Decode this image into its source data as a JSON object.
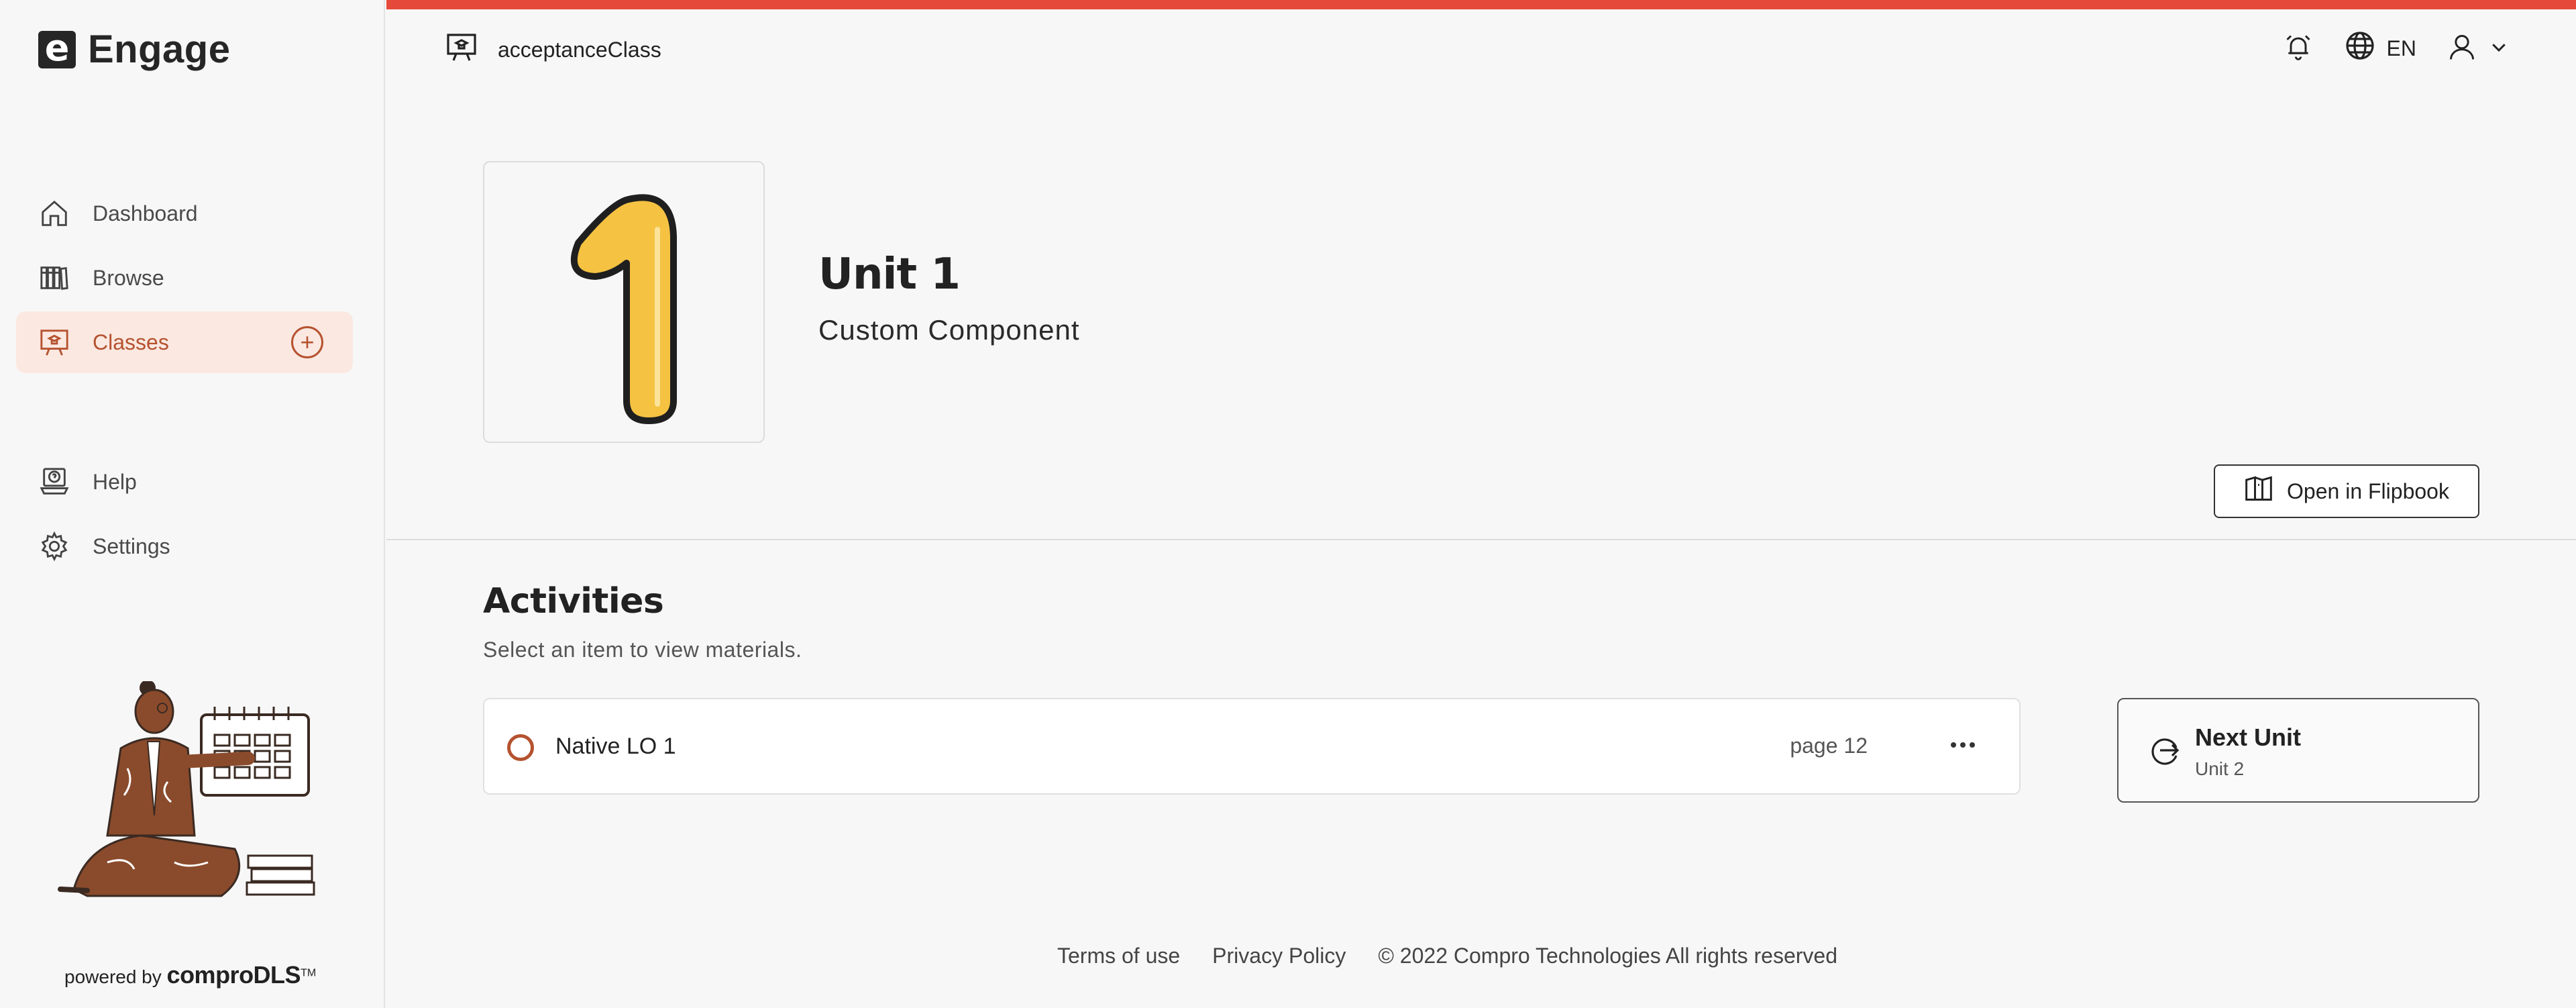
{
  "app": {
    "name": "Engage",
    "logo_letter": "e"
  },
  "sidebar": {
    "items": [
      {
        "label": "Dashboard",
        "icon": "home-icon"
      },
      {
        "label": "Browse",
        "icon": "books-icon"
      },
      {
        "label": "Classes",
        "icon": "classroom-icon",
        "active": true
      }
    ],
    "items2": [
      {
        "label": "Help",
        "icon": "help-icon"
      },
      {
        "label": "Settings",
        "icon": "gear-icon"
      }
    ],
    "powered_by": "powered by",
    "powered_brand": "comproDLS",
    "powered_tm": "TM"
  },
  "topbar": {
    "class_name": "acceptanceClass",
    "language": "EN"
  },
  "unit": {
    "number_glyph": "1",
    "title": "Unit 1",
    "subtitle": "Custom Component",
    "flipbook_label": "Open in Flipbook"
  },
  "activities": {
    "title": "Activities",
    "subtitle": "Select an item to view materials.",
    "items": [
      {
        "name": "Native LO 1",
        "page": "page 12"
      }
    ]
  },
  "next_unit": {
    "label": "Next Unit",
    "sub": "Unit 2"
  },
  "footer": {
    "terms": "Terms of use",
    "privacy": "Privacy Policy",
    "copyright": "© 2022 Compro Technologies All rights reserved"
  },
  "colors": {
    "accent": "#b5522f",
    "top_stripe": "#e5493a",
    "active_bg": "#fbe8e1",
    "unit_number_fill": "#f5c242"
  }
}
